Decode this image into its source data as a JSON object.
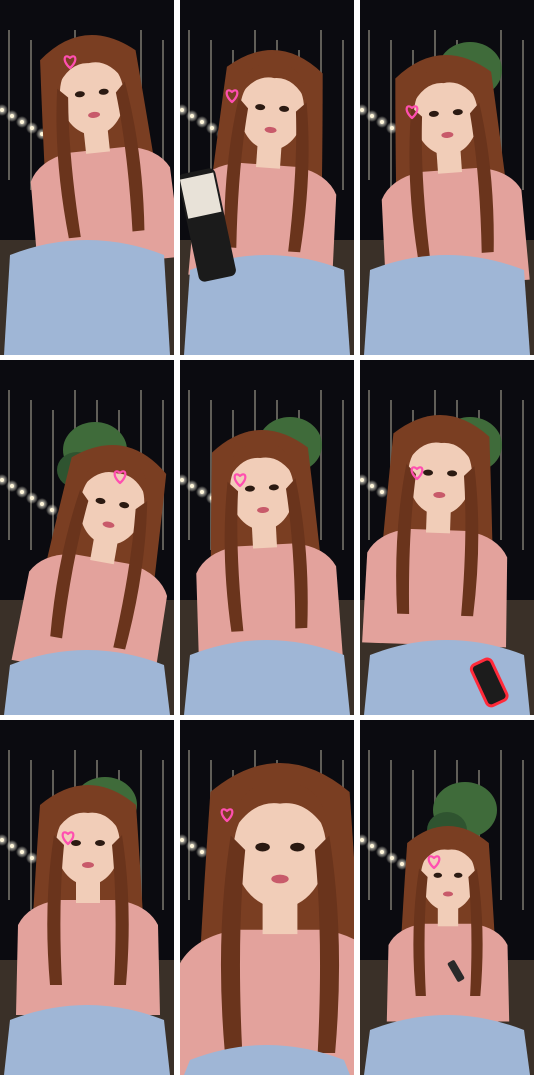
{
  "grid": {
    "rows": 3,
    "columns": 3
  },
  "palette": {
    "night_sky": "#0b0b10",
    "hair": "#7a3e22",
    "skin": "#f1cdb8",
    "top": "#e3a29c",
    "jeans": "#9fb6d6",
    "lights": "#fff6da",
    "heart": "#ff4fb0",
    "tree": "#3f6b3a"
  },
  "frames": [
    {
      "id": "frame-1",
      "heart_icon": "heart-icon",
      "pose": "looking-up"
    },
    {
      "id": "frame-2",
      "heart_icon": "heart-icon",
      "pose": "drinking-bottle"
    },
    {
      "id": "frame-3",
      "heart_icon": "heart-icon",
      "pose": "leaning"
    },
    {
      "id": "frame-4",
      "heart_icon": "heart-icon",
      "pose": "head-tilt"
    },
    {
      "id": "frame-5",
      "heart_icon": "heart-icon",
      "pose": "looking-side"
    },
    {
      "id": "frame-6",
      "heart_icon": "heart-icon",
      "pose": "holding-phone"
    },
    {
      "id": "frame-7",
      "heart_icon": "heart-icon",
      "pose": "eyes-closed"
    },
    {
      "id": "frame-8",
      "heart_icon": "heart-icon",
      "pose": "close-up"
    },
    {
      "id": "frame-9",
      "heart_icon": "heart-icon",
      "pose": "holding-lighter"
    }
  ]
}
